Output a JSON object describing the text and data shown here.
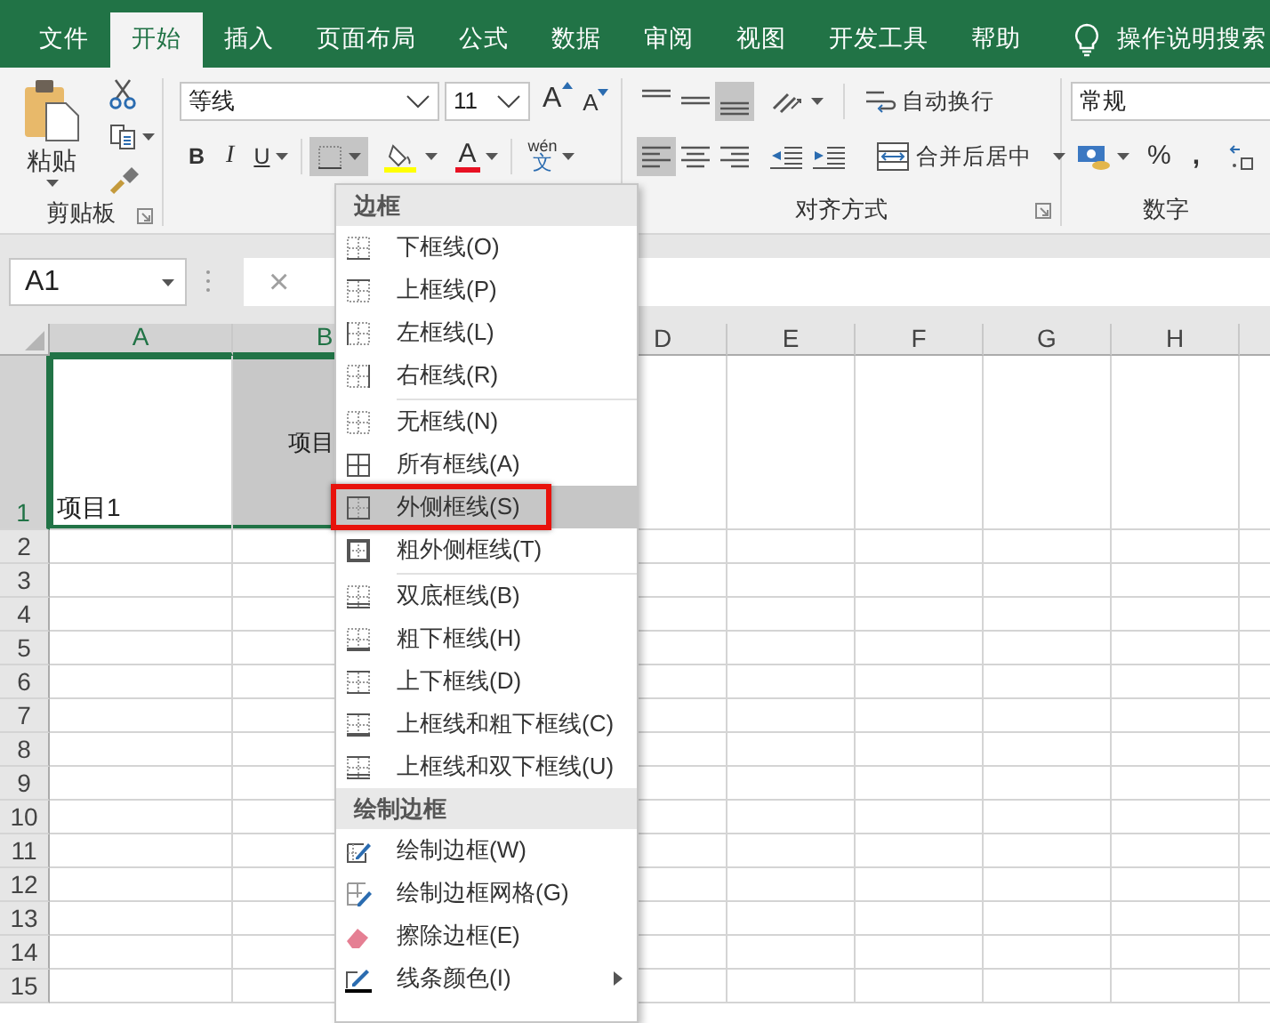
{
  "tabs": [
    {
      "label": "文件",
      "selected": false
    },
    {
      "label": "开始",
      "selected": true
    },
    {
      "label": "插入",
      "selected": false
    },
    {
      "label": "页面布局",
      "selected": false
    },
    {
      "label": "公式",
      "selected": false
    },
    {
      "label": "数据",
      "selected": false
    },
    {
      "label": "审阅",
      "selected": false
    },
    {
      "label": "视图",
      "selected": false
    },
    {
      "label": "开发工具",
      "selected": false
    },
    {
      "label": "帮助",
      "selected": false
    }
  ],
  "tell_me": {
    "label": "操作说明搜索"
  },
  "ribbon": {
    "groups": [
      {
        "kind": "clipboard",
        "paste": "粘贴",
        "label": "剪贴板"
      },
      {
        "kind": "font",
        "font_name": "等线",
        "font_size": "11",
        "grow": "A",
        "shrink": "A",
        "bold": "B",
        "italic": "I",
        "underline": "U",
        "font_color": "A",
        "phonetic_top": "wén",
        "phonetic_char": "文",
        "border_pressed": true
      },
      {
        "kind": "alignment",
        "vertical_align": [
          {
            "selected": false
          },
          {
            "selected": false
          },
          {
            "selected": true
          }
        ],
        "horizontal_align": [
          {
            "selected": true
          },
          {
            "selected": false
          },
          {
            "selected": false
          }
        ],
        "wrap_text": "自动换行",
        "merge": "合并后居中",
        "label": "对齐方式"
      },
      {
        "kind": "number",
        "format": "常规",
        "percent": "%",
        "comma": ",",
        "label": "数字"
      }
    ]
  },
  "formula_bar": {
    "name_box": "A1",
    "cancel": "×"
  },
  "columns": [
    {
      "label": "A",
      "selected": true
    },
    {
      "label": "B",
      "selected": true
    },
    {
      "label": "D",
      "selected": false
    },
    {
      "label": "E",
      "selected": false
    },
    {
      "label": "F",
      "selected": false
    },
    {
      "label": "G",
      "selected": false
    },
    {
      "label": "H",
      "selected": false
    }
  ],
  "rows": [
    {
      "header": "1",
      "selected": true,
      "cells": [
        {
          "text": "项目1",
          "selected": true,
          "active": true
        },
        {
          "text": "项目",
          "selected": true,
          "active": false
        }
      ]
    },
    {
      "header": "2",
      "selected": false
    },
    {
      "header": "3",
      "selected": false
    },
    {
      "header": "4",
      "selected": false
    },
    {
      "header": "5",
      "selected": false
    },
    {
      "header": "6",
      "selected": false
    },
    {
      "header": "7",
      "selected": false
    },
    {
      "header": "8",
      "selected": false
    },
    {
      "header": "9",
      "selected": false
    },
    {
      "header": "10",
      "selected": false
    },
    {
      "header": "11",
      "selected": false
    },
    {
      "header": "12",
      "selected": false
    },
    {
      "header": "13",
      "selected": false
    },
    {
      "header": "14",
      "selected": false
    },
    {
      "header": "15",
      "selected": false
    }
  ],
  "border_menu": {
    "sections": [
      {
        "title": "边框",
        "groups": [
          [
            {
              "label": "下框线(O)",
              "selected": false,
              "annotated": false,
              "submenu": false
            },
            {
              "label": "上框线(P)",
              "selected": false,
              "annotated": false,
              "submenu": false
            },
            {
              "label": "左框线(L)",
              "selected": false,
              "annotated": false,
              "submenu": false
            },
            {
              "label": "右框线(R)",
              "selected": false,
              "annotated": false,
              "submenu": false
            }
          ],
          [
            {
              "label": "无框线(N)",
              "selected": false,
              "annotated": false,
              "submenu": false
            },
            {
              "label": "所有框线(A)",
              "selected": false,
              "annotated": false,
              "submenu": false
            },
            {
              "label": "外侧框线(S)",
              "selected": true,
              "annotated": true,
              "submenu": false
            },
            {
              "label": "粗外侧框线(T)",
              "selected": false,
              "annotated": false,
              "submenu": false
            }
          ],
          [
            {
              "label": "双底框线(B)",
              "selected": false,
              "annotated": false,
              "submenu": false
            },
            {
              "label": "粗下框线(H)",
              "selected": false,
              "annotated": false,
              "submenu": false
            },
            {
              "label": "上下框线(D)",
              "selected": false,
              "annotated": false,
              "submenu": false
            },
            {
              "label": "上框线和粗下框线(C)",
              "selected": false,
              "annotated": false,
              "submenu": false
            },
            {
              "label": "上框线和双下框线(U)",
              "selected": false,
              "annotated": false,
              "submenu": false
            }
          ]
        ]
      },
      {
        "title": "绘制边框",
        "groups": [
          [
            {
              "label": "绘制边框(W)",
              "selected": false,
              "annotated": false,
              "submenu": false
            },
            {
              "label": "绘制边框网格(G)",
              "selected": false,
              "annotated": false,
              "submenu": false
            },
            {
              "label": "擦除边框(E)",
              "selected": false,
              "annotated": false,
              "submenu": false
            },
            {
              "label": "线条颜色(I)",
              "selected": false,
              "annotated": false,
              "submenu": true
            }
          ]
        ]
      }
    ]
  }
}
